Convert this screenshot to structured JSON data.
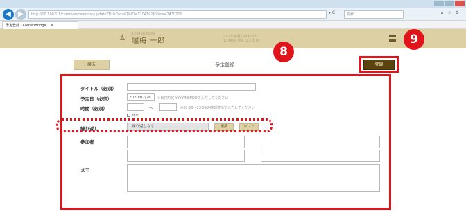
{
  "browser": {
    "url": "http://10.100.1.1/common/calendar/update?TitleDetail1&ID=1204191&View=2430210",
    "url_controls": "▾ C",
    "search_placeholder": "検索...",
    "right_controls": "⌂ ☆ ⚙",
    "tab_title": "予定登録 - KomenBridge...  ×",
    "back_glyph": "◀",
    "forward_glyph": "▶",
    "back_icon": "arrow-left-icon",
    "forward_icon": "arrow-right-icon"
  },
  "header": {
    "user_sub": "123456-0001",
    "user_name": "堀梅 一郎",
    "user_icon": "user-icon",
    "user_glyph": "♙",
    "mid_info_line1": "ホスト会社1234567",
    "mid_info_line2": "123456789 123 支店",
    "icon1_label": "設定\n設定",
    "icon1_name": "settings-icon",
    "icon2_name": "logout-icon"
  },
  "toolbar": {
    "back_label": "戻る",
    "page_title": "予定登録",
    "register_label": "登録"
  },
  "callouts": {
    "form_number": "8",
    "register_number": "9"
  },
  "form": {
    "title_label": "タイトル（必須）",
    "title_value": "",
    "date_label": "予定日（必須）",
    "date_value": "2020/02/26",
    "date_hint": "※日付形式 YYYY/MM/DDで入力してください",
    "time_label": "時間（必須）",
    "time_start": "",
    "time_tilde": "〜",
    "time_end": "",
    "time_hint": "※00:00～23:59の時刻表示で入力してください",
    "allday_label": "終日",
    "repeat_label": "繰り返し",
    "repeat_value": "繰り返しなし",
    "repeat_set_label": "選択",
    "repeat_clear_label": "クリア",
    "participants_label": "参加者",
    "memo_label": "メモ",
    "memo_value": ""
  }
}
